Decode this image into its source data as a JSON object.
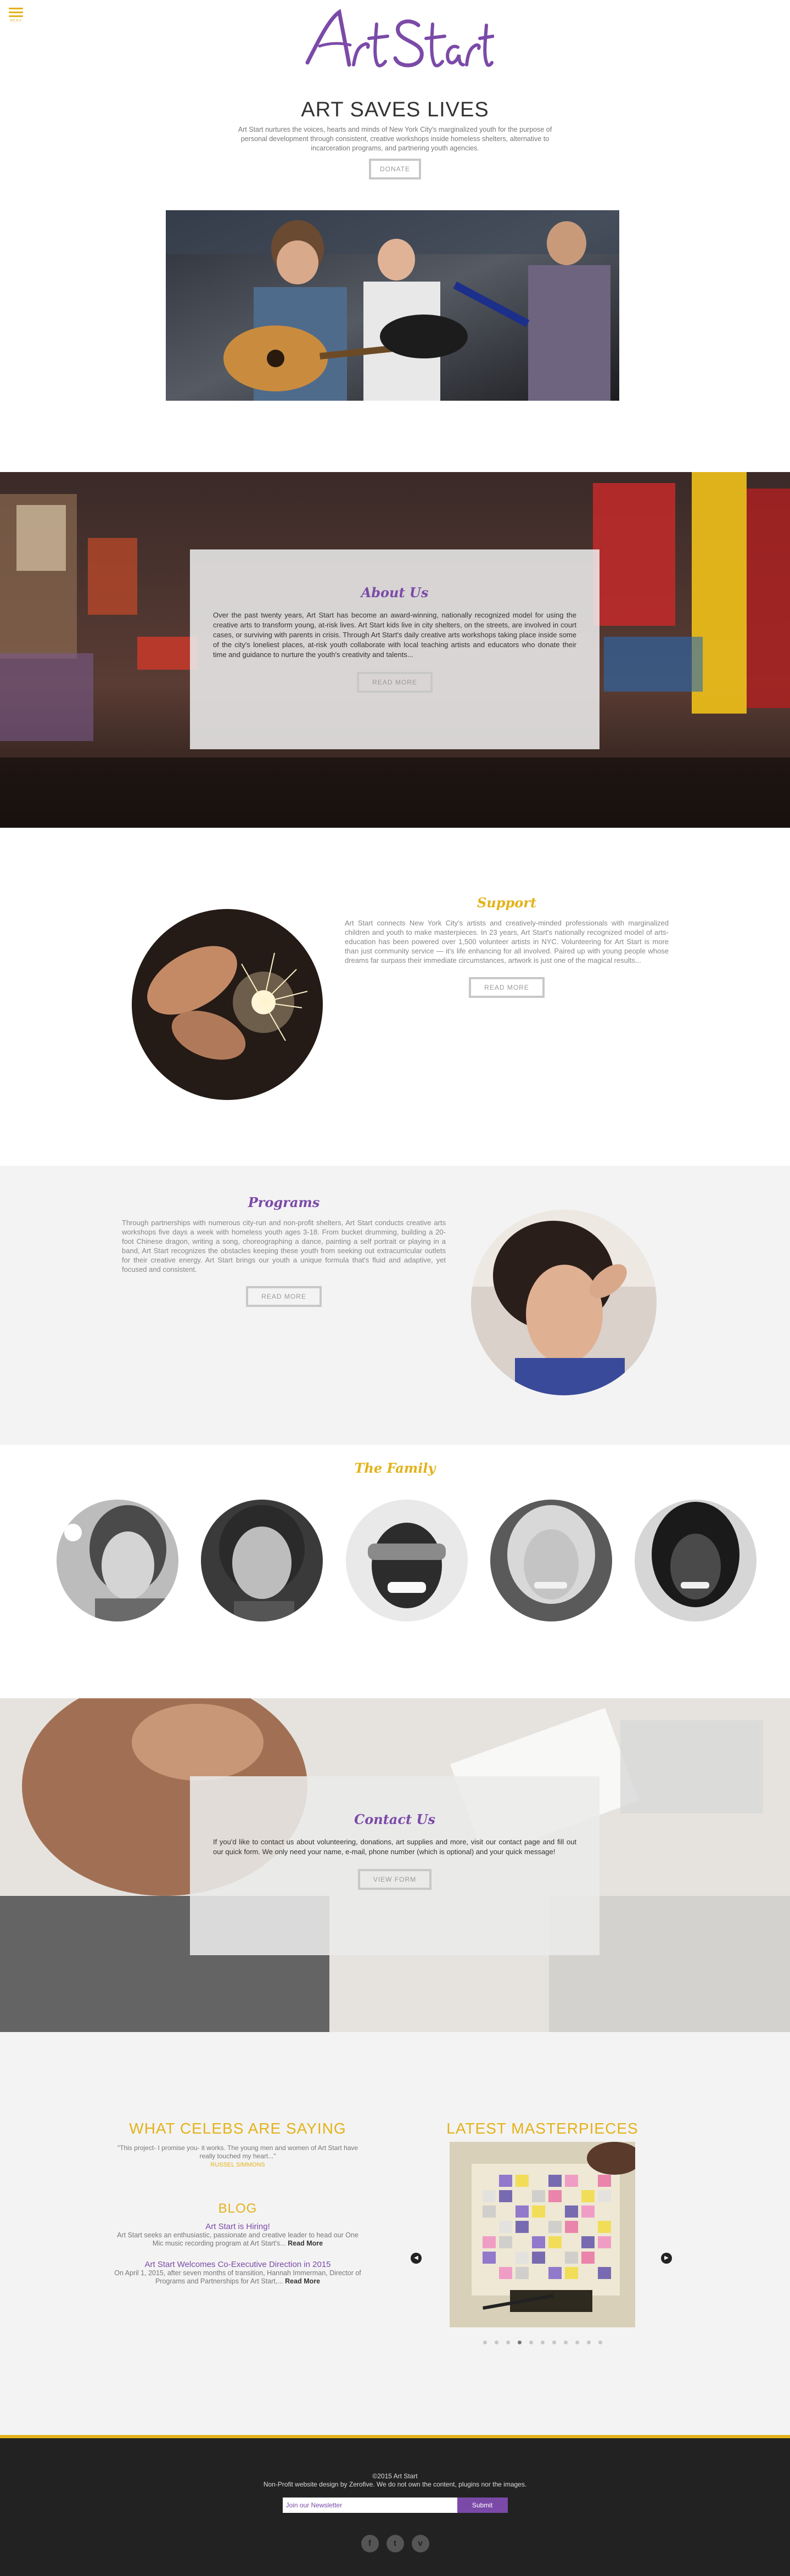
{
  "menu": {
    "label": "MENU"
  },
  "hero": {
    "logo_text": "Art Start",
    "headline": "ART SAVES LIVES",
    "text": "Art Start nurtures the voices, hearts and minds of New York City's marginalized youth for the purpose of personal development through consistent, creative workshops inside homeless shelters, alternative to incarceration programs, and partnering youth agencies.",
    "donate_label": "DONATE"
  },
  "about": {
    "title": "About Us",
    "text": "Over the past twenty years, Art Start has become an award-winning, nationally recognized model for using the creative arts to transform young, at-risk lives. Art Start kids live in city shelters, on the streets, are involved in court cases, or surviving with parents in crisis. Through Art Start's daily creative arts workshops taking place inside some of the city's loneliest places, at-risk youth collaborate with local teaching artists and educators who donate their time and guidance to nurture the youth's creativity and talents...",
    "button": "READ MORE"
  },
  "support": {
    "title": "Support",
    "text": "Art Start connects New York City's artists and creatively-minded professionals with marginalized children and youth to make masterpieces. In 23 years, Art Start's nationally recognized model of arts-education has been powered over 1,500 volunteer artists in NYC. Volunteering for Art Start is more than just community service — it's life enhancing for all involved. Paired up with young people whose dreams far surpass their immediate circumstances, artwork is just one of the magical results...",
    "button": "READ MORE"
  },
  "programs": {
    "title": "Programs",
    "text": "Through partnerships with numerous city-run and non-profit shelters, Art Start conducts creative arts workshops five days a week with homeless youth ages 3-18. From bucket drumming, building a 20- foot Chinese dragon, writing a song, choreographing a dance, painting a self portrait or playing in a band, Art Start recognizes the obstacles keeping these youth from seeking out extracurricular outlets for their creative energy. Art Start brings our youth a unique formula that's fluid and adaptive, yet focused and consistent.",
    "button": "READ MORE"
  },
  "family": {
    "title": "The Family"
  },
  "contact": {
    "title": "Contact Us",
    "text": "If you'd like to contact us about volunteering, donations, art supplies and more, visit our contact page and fill out our quick form. We only need your name, e-mail, phone number (which is optional) and your quick message!",
    "button": "VIEW FORM"
  },
  "celebs": {
    "title": "WHAT CELEBS ARE SAYING",
    "quote": "\"This project- I promise you- it works. The young men and women of Art Start have really touched my heart...\"",
    "author": "RUSSEL SIMMONS"
  },
  "blog": {
    "title": "BLOG",
    "posts": [
      {
        "title": "Art Start is Hiring!",
        "text": "Art Start seeks an enthusiastic, passionate and creative leader to head our One Mic music recording program at Art Start's...",
        "link": "Read More"
      },
      {
        "title": "Art Start Welcomes Co-Executive Direction in 2015",
        "text": "On April 1, 2015, after seven months of transition, Hannah Immerman, Director of Programs and Partnerships for Art Start,...",
        "link": "Read More"
      }
    ]
  },
  "gallery": {
    "title": "LATEST MASTERPIECES",
    "prev_icon": "◀",
    "next_icon": "▶",
    "dot_count": 11,
    "active_index": 3
  },
  "footer": {
    "copyright": "©2015 Art Start",
    "credit": "Non-Profit website design by Zerofive. We do not own the content, plugins nor the images.",
    "newsletter_placeholder": "Join our Newsletter",
    "submit": "Submit",
    "social": [
      {
        "name": "facebook-icon",
        "glyph": "f"
      },
      {
        "name": "twitter-icon",
        "glyph": "t"
      },
      {
        "name": "vimeo-icon",
        "glyph": "v"
      }
    ]
  },
  "colors": {
    "accent_gold": "#e3b21a",
    "accent_purple": "#7b4aa8",
    "footer_bg": "#222222"
  }
}
